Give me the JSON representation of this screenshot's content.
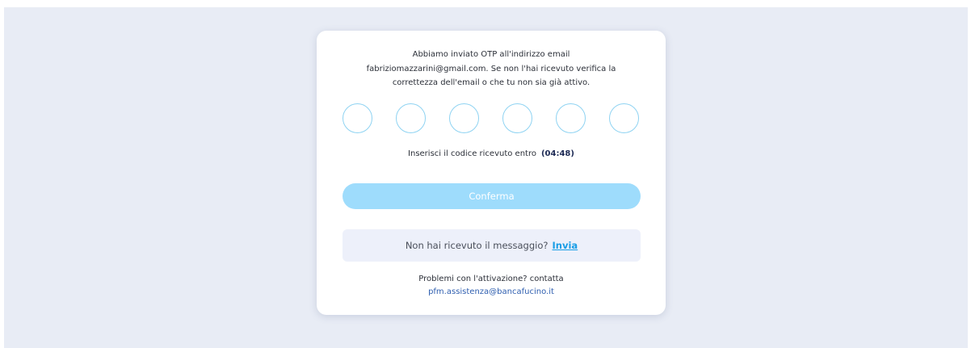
{
  "verification": {
    "message_line1": "Abbiamo inviato OTP all'indirizzo email",
    "message_line2": "fabriziomazzarini@gmail.com. Se non l'hai ricevuto verifica la",
    "message_line3": "correttezza dell'email o che tu non sia già attivo.",
    "otp_digits": [
      "",
      "",
      "",
      "",
      "",
      ""
    ],
    "timer_label": "Inserisci il codice ricevuto entro",
    "timer_value": "(04:48)",
    "confirm_label": "Conferma",
    "resend_prompt": "Non hai ricevuto il messaggio?",
    "resend_link": "Invia",
    "problems_text": "Problemi con l'attivazione? contatta",
    "support_email": "pfm.assistenza@bancafucino.it"
  },
  "colors": {
    "page_background": "#e8ecf5",
    "card_background": "#ffffff",
    "otp_border": "#8fd3f2",
    "confirm_button": "#9edcfc",
    "resend_background": "#edf0fa",
    "link": "#1a9ee6",
    "support_link": "#2f5fb0"
  }
}
